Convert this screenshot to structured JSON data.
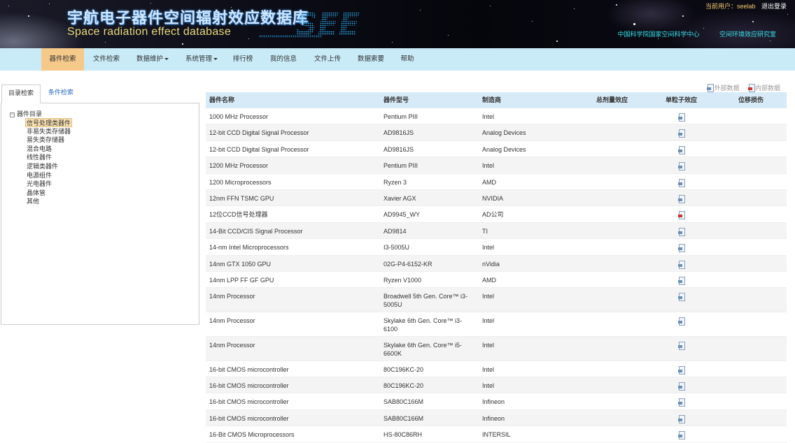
{
  "header": {
    "title_cn": "宇航电子器件空间辐射效应数据库",
    "title_en": "Space radiation effect database",
    "logo_text": "SEE",
    "user_label": "当前用户：seelab",
    "logout": "退出登录",
    "org_links": [
      "中国科学院国家空间科学中心",
      "空间环境效应研究室"
    ]
  },
  "nav": {
    "items": [
      {
        "label": "器件检索",
        "active": true
      },
      {
        "label": "文件检索"
      },
      {
        "label": "数据维护",
        "dropdown": true
      },
      {
        "label": "系统管理",
        "dropdown": true
      },
      {
        "label": "排行榜"
      },
      {
        "label": "我的信息"
      },
      {
        "label": "文件上传"
      },
      {
        "label": "数据索要"
      },
      {
        "label": "帮助"
      }
    ]
  },
  "sidebar": {
    "tabs": [
      "目录检索",
      "条件检索"
    ],
    "tree": {
      "root": "器件目录",
      "toggle": "−",
      "children": [
        "信号处理类器件",
        "非易失类存储器",
        "易失类存储器",
        "混合电路",
        "线性器件",
        "逻辑类器件",
        "电源组件",
        "光电器件",
        "晶体管",
        "其他"
      ],
      "selected_index": 0
    }
  },
  "legend": {
    "external": "外部数据",
    "internal": "内部数据"
  },
  "table": {
    "columns": [
      "器件名称",
      "器件型号",
      "制造商",
      "总剂量效应",
      "单粒子效应",
      "位移损伤"
    ],
    "rows": [
      {
        "name": "1000 MHz Processor",
        "model": "Pentium PIII",
        "maker": "Intel",
        "see_icon": "external"
      },
      {
        "name": "12-bit CCD Digital Signal Processor",
        "model": "AD9816JS",
        "maker": "Analog Devices",
        "see_icon": "external"
      },
      {
        "name": "12-bit CCD Digital Signal Processor",
        "model": "AD9816JS",
        "maker": "Analog    Devices",
        "see_icon": "external"
      },
      {
        "name": "1200 MHz Processor",
        "model": "Pentium PIII",
        "maker": "Intel",
        "see_icon": "external"
      },
      {
        "name": "1200 Microprocessors",
        "model": "Ryzen 3",
        "maker": "AMD",
        "see_icon": "external"
      },
      {
        "name": "12nm FFN TSMC GPU",
        "model": "Xavier AGX",
        "maker": "NVIDIA",
        "see_icon": "external"
      },
      {
        "name": "12位CCD信号处理器",
        "model": "AD9945_WY",
        "maker": "AD公司",
        "see_icon": "internal"
      },
      {
        "name": "14-Bit CCD/CIS Signal Processor",
        "model": "AD9814",
        "maker": "TI",
        "see_icon": "external"
      },
      {
        "name": "14-nm Intel Microprocessors",
        "model": "I3-5005U",
        "maker": "Intel",
        "see_icon": "external"
      },
      {
        "name": "14nm GTX 1050 GPU",
        "model": "02G-P4-6152-KR",
        "maker": "nVidia",
        "see_icon": "external"
      },
      {
        "name": "14nm LPP FF GF GPU",
        "model": "Ryzen V1000",
        "maker": "AMD",
        "see_icon": "external"
      },
      {
        "name": "14nm Processor",
        "model": "Broadwell 5th Gen. Core™ i3-5005U",
        "maker": "Intel",
        "see_icon": "external",
        "tall": true
      },
      {
        "name": "14nm Processor",
        "model": "Skylake 6th Gen. Core™ i3-6100",
        "maker": "Intel",
        "see_icon": "external",
        "tall": true
      },
      {
        "name": "14nm Processor",
        "model": "Skylake 6th Gen. Core™ i5-6600K",
        "maker": "Intel",
        "see_icon": "external",
        "tall": true
      },
      {
        "name": "16-bit CMOS microcontroller",
        "model": "80C196KC-20",
        "maker": "Intel",
        "see_icon": "external"
      },
      {
        "name": "16-bit CMOS microcontroller",
        "model": "80C196KC-20",
        "maker": "Intel",
        "see_icon": "external"
      },
      {
        "name": "16-bit CMOS microcontroller",
        "model": "SAB80C166M",
        "maker": "Infineon",
        "see_icon": "external"
      },
      {
        "name": "16-bit CMOS microcontroller",
        "model": "SAB80C166M",
        "maker": "Infineon",
        "see_icon": "external"
      },
      {
        "name": "16-Bit CMOS Microprocessors",
        "model": "HS-80C86RH",
        "maker": "INTERSIL",
        "see_icon": "external"
      }
    ]
  },
  "colors": {
    "nav_bg": "#c9ebf8",
    "nav_active": "#f5c98a",
    "table_header": "#d7eaf7",
    "link": "#2b6fc2",
    "internal_icon": "#d0312d",
    "external_icon": "#6b8fb8"
  }
}
